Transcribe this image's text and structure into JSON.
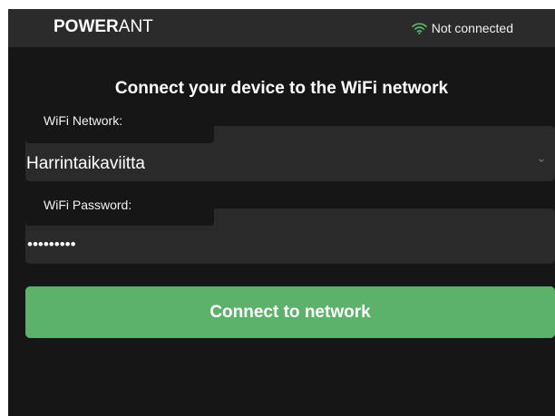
{
  "header": {
    "brand_bold": "POWER",
    "brand_light": "ANT",
    "status_text": "Not connected",
    "status_icon": "wifi-icon",
    "status_color": "#5cb26a"
  },
  "main": {
    "title": "Connect your device to the WiFi network",
    "network": {
      "label": "WiFi Network:",
      "value": "Harrintaikaviitta"
    },
    "password": {
      "label": "WiFi Password:",
      "value": "•••••••••"
    },
    "connect_button_label": "Connect to network",
    "accent_color": "#5cb26a"
  }
}
